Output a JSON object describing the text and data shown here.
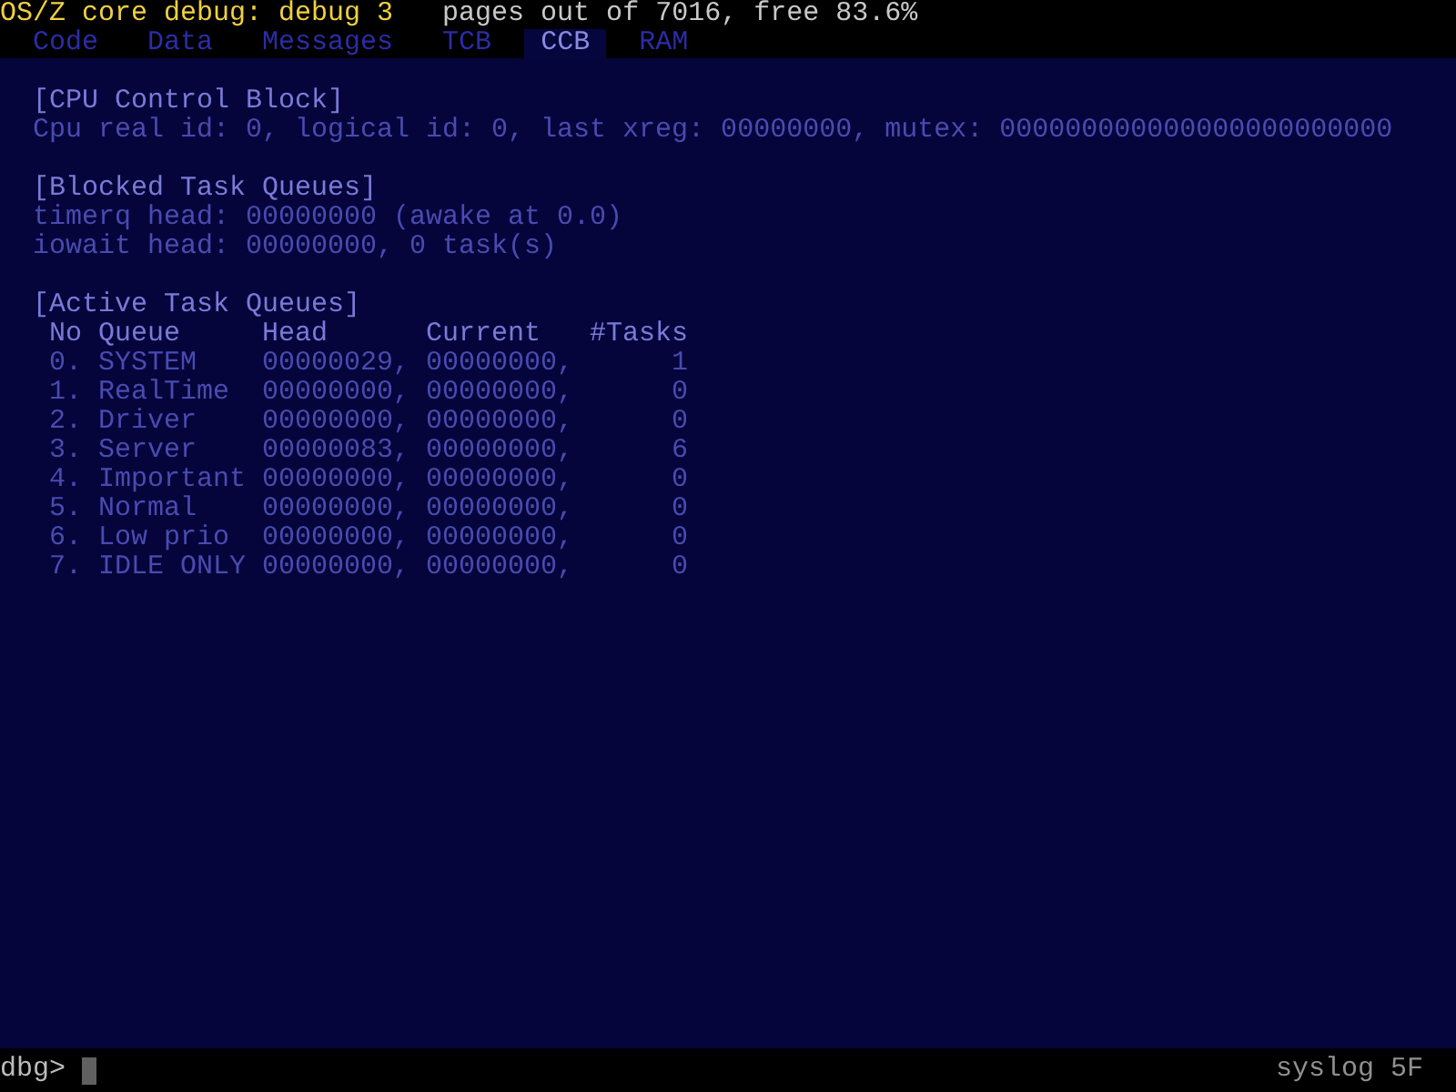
{
  "header": {
    "title": "OS/Z core debug: debug 3",
    "status": "pages out of 7016, free 83.6%"
  },
  "tabs": [
    {
      "label": "Code",
      "selected": false
    },
    {
      "label": "Data",
      "selected": false
    },
    {
      "label": "Messages",
      "selected": false
    },
    {
      "label": "TCB",
      "selected": false
    },
    {
      "label": "CCB",
      "selected": true
    },
    {
      "label": "RAM",
      "selected": false
    }
  ],
  "sections": [
    {
      "heading": "[CPU Control Block]",
      "lines": [
        "Cpu real id: 0, logical id: 0, last xreg: 00000000, mutex: 000000000000000000000000"
      ]
    },
    {
      "heading": "[Blocked Task Queues]",
      "lines": [
        "timerq head: 00000000 (awake at 0.0)",
        "iowait head: 00000000, 0 task(s)"
      ]
    },
    {
      "heading": "[Active Task Queues]",
      "table": {
        "columns": [
          "No",
          "Queue",
          "Head",
          "Current",
          "#Tasks"
        ],
        "rows": [
          [
            "0.",
            "SYSTEM",
            "00000029,",
            "00000000,",
            "1"
          ],
          [
            "1.",
            "RealTime",
            "00000000,",
            "00000000,",
            "0"
          ],
          [
            "2.",
            "Driver",
            "00000000,",
            "00000000,",
            "0"
          ],
          [
            "3.",
            "Server",
            "00000083,",
            "00000000,",
            "6"
          ],
          [
            "4.",
            "Important",
            "00000000,",
            "00000000,",
            "0"
          ],
          [
            "5.",
            "Normal",
            "00000000,",
            "00000000,",
            "0"
          ],
          [
            "6.",
            "Low prio",
            "00000000,",
            "00000000,",
            "0"
          ],
          [
            "7.",
            "IDLE ONLY",
            "00000000,",
            "00000000,",
            "0"
          ]
        ]
      }
    }
  ],
  "command_line": {
    "prompt": "dbg>",
    "log_label": "syslog 5F"
  }
}
